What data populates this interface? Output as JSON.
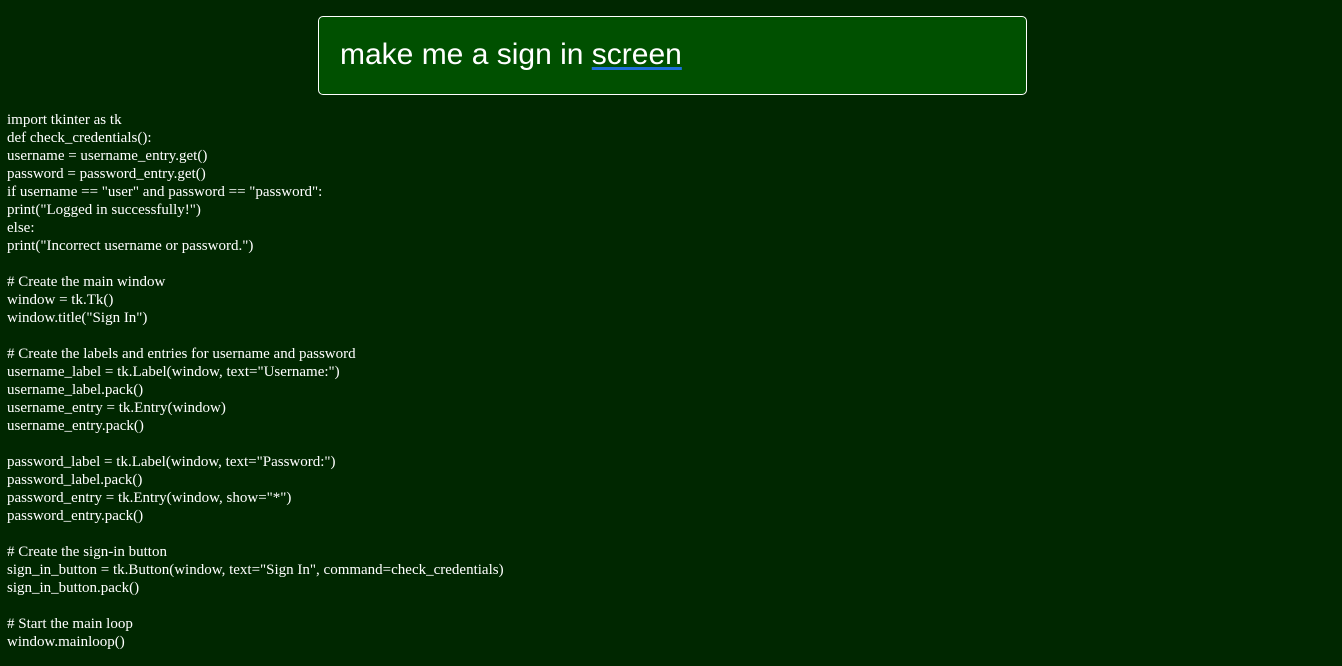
{
  "prompt": {
    "text_before": "make me a sign in ",
    "underlined_word": "screen"
  },
  "code_lines": [
    "import tkinter as tk",
    "def check_credentials():",
    "username = username_entry.get()",
    "password = password_entry.get()",
    "if username == \"user\" and password == \"password\":",
    "print(\"Logged in successfully!\")",
    "else:",
    "print(\"Incorrect username or password.\")",
    "",
    "# Create the main window",
    "window = tk.Tk()",
    "window.title(\"Sign In\")",
    "",
    "# Create the labels and entries for username and password",
    "username_label = tk.Label(window, text=\"Username:\")",
    "username_label.pack()",
    "username_entry = tk.Entry(window)",
    "username_entry.pack()",
    "",
    "password_label = tk.Label(window, text=\"Password:\")",
    "password_label.pack()",
    "password_entry = tk.Entry(window, show=\"*\")",
    "password_entry.pack()",
    "",
    "# Create the sign-in button",
    "sign_in_button = tk.Button(window, text=\"Sign In\", command=check_credentials)",
    "sign_in_button.pack()",
    "",
    "# Start the main loop",
    "window.mainloop()"
  ],
  "colors": {
    "page_background": "#002700",
    "prompt_background": "#005000",
    "text": "#ffffff",
    "spellcheck_underline": "#1e6fd9"
  }
}
